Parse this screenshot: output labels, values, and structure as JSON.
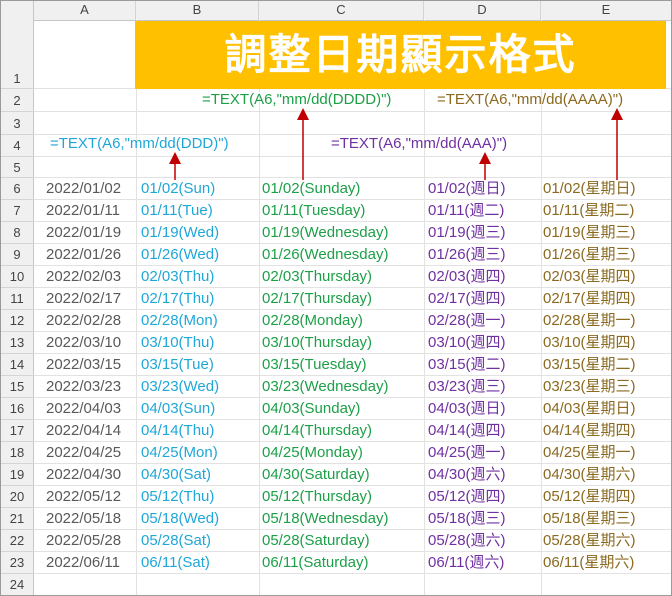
{
  "columns": [
    "A",
    "B",
    "C",
    "D",
    "E"
  ],
  "row_numbers": [
    "1",
    "2",
    "3",
    "4",
    "5",
    "6",
    "7",
    "8",
    "9",
    "10",
    "11",
    "12",
    "13",
    "14",
    "15",
    "16",
    "17",
    "18",
    "19",
    "20",
    "21",
    "22",
    "23",
    "24"
  ],
  "title": "調整日期顯示格式",
  "formulas": {
    "dddd": "=TEXT(A6,\"mm/dd(DDDD)\")",
    "aaaa": "=TEXT(A6,\"mm/dd(AAAA)\")",
    "ddd": "=TEXT(A6,\"mm/dd(DDD)\")",
    "aaa": "=TEXT(A6,\"mm/dd(AAA)\")"
  },
  "colors": {
    "title_bg": "#ffc000",
    "col_b": "#1fa7d8",
    "col_c": "#1c9f47",
    "col_d": "#7030a0",
    "col_e": "#8b6a20",
    "arrow": "#c00000"
  },
  "rows": [
    {
      "date": "2022/01/02",
      "ddd": "01/02(Sun)",
      "dddd": "01/02(Sunday)",
      "aaa": "01/02(週日)",
      "aaaa": "01/02(星期日)"
    },
    {
      "date": "2022/01/11",
      "ddd": "01/11(Tue)",
      "dddd": "01/11(Tuesday)",
      "aaa": "01/11(週二)",
      "aaaa": "01/11(星期二)"
    },
    {
      "date": "2022/01/19",
      "ddd": "01/19(Wed)",
      "dddd": "01/19(Wednesday)",
      "aaa": "01/19(週三)",
      "aaaa": "01/19(星期三)"
    },
    {
      "date": "2022/01/26",
      "ddd": "01/26(Wed)",
      "dddd": "01/26(Wednesday)",
      "aaa": "01/26(週三)",
      "aaaa": "01/26(星期三)"
    },
    {
      "date": "2022/02/03",
      "ddd": "02/03(Thu)",
      "dddd": "02/03(Thursday)",
      "aaa": "02/03(週四)",
      "aaaa": "02/03(星期四)"
    },
    {
      "date": "2022/02/17",
      "ddd": "02/17(Thu)",
      "dddd": "02/17(Thursday)",
      "aaa": "02/17(週四)",
      "aaaa": "02/17(星期四)"
    },
    {
      "date": "2022/02/28",
      "ddd": "02/28(Mon)",
      "dddd": "02/28(Monday)",
      "aaa": "02/28(週一)",
      "aaaa": "02/28(星期一)"
    },
    {
      "date": "2022/03/10",
      "ddd": "03/10(Thu)",
      "dddd": "03/10(Thursday)",
      "aaa": "03/10(週四)",
      "aaaa": "03/10(星期四)"
    },
    {
      "date": "2022/03/15",
      "ddd": "03/15(Tue)",
      "dddd": "03/15(Tuesday)",
      "aaa": "03/15(週二)",
      "aaaa": "03/15(星期二)"
    },
    {
      "date": "2022/03/23",
      "ddd": "03/23(Wed)",
      "dddd": "03/23(Wednesday)",
      "aaa": "03/23(週三)",
      "aaaa": "03/23(星期三)"
    },
    {
      "date": "2022/04/03",
      "ddd": "04/03(Sun)",
      "dddd": "04/03(Sunday)",
      "aaa": "04/03(週日)",
      "aaaa": "04/03(星期日)"
    },
    {
      "date": "2022/04/14",
      "ddd": "04/14(Thu)",
      "dddd": "04/14(Thursday)",
      "aaa": "04/14(週四)",
      "aaaa": "04/14(星期四)"
    },
    {
      "date": "2022/04/25",
      "ddd": "04/25(Mon)",
      "dddd": "04/25(Monday)",
      "aaa": "04/25(週一)",
      "aaaa": "04/25(星期一)"
    },
    {
      "date": "2022/04/30",
      "ddd": "04/30(Sat)",
      "dddd": "04/30(Saturday)",
      "aaa": "04/30(週六)",
      "aaaa": "04/30(星期六)"
    },
    {
      "date": "2022/05/12",
      "ddd": "05/12(Thu)",
      "dddd": "05/12(Thursday)",
      "aaa": "05/12(週四)",
      "aaaa": "05/12(星期四)"
    },
    {
      "date": "2022/05/18",
      "ddd": "05/18(Wed)",
      "dddd": "05/18(Wednesday)",
      "aaa": "05/18(週三)",
      "aaaa": "05/18(星期三)"
    },
    {
      "date": "2022/05/28",
      "ddd": "05/28(Sat)",
      "dddd": "05/28(Saturday)",
      "aaa": "05/28(週六)",
      "aaaa": "05/28(星期六)"
    },
    {
      "date": "2022/06/11",
      "ddd": "06/11(Sat)",
      "dddd": "06/11(Saturday)",
      "aaa": "06/11(週六)",
      "aaaa": "06/11(星期六)"
    }
  ]
}
